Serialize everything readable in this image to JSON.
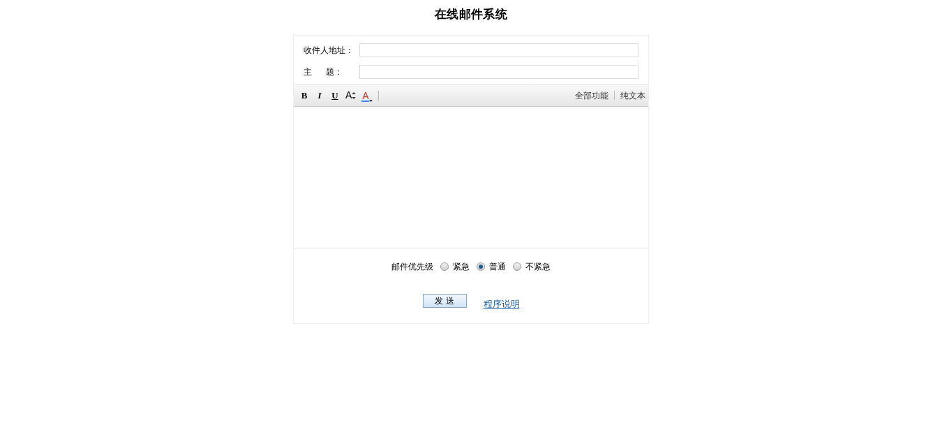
{
  "title": "在线邮件系统",
  "fields": [
    {
      "label": "收件人地址："
    },
    {
      "label": "主      题："
    }
  ],
  "toolbar": {
    "buttons": [
      {
        "kind": "bold",
        "label": "B"
      },
      {
        "kind": "italic",
        "label": "I"
      },
      {
        "kind": "underline",
        "label": "U"
      },
      {
        "kind": "fontsize",
        "label": "A"
      },
      {
        "kind": "color",
        "label": "A",
        "color": "#c0392b"
      }
    ],
    "links": [
      "全部功能",
      "纯文本"
    ]
  },
  "priority": {
    "label": "邮件优先级",
    "options": [
      {
        "label": "紧急",
        "selected": false
      },
      {
        "label": "普通",
        "selected": true
      },
      {
        "label": "不紧急",
        "selected": false
      }
    ]
  },
  "send_button": "发 送",
  "help_link": "程序说明"
}
